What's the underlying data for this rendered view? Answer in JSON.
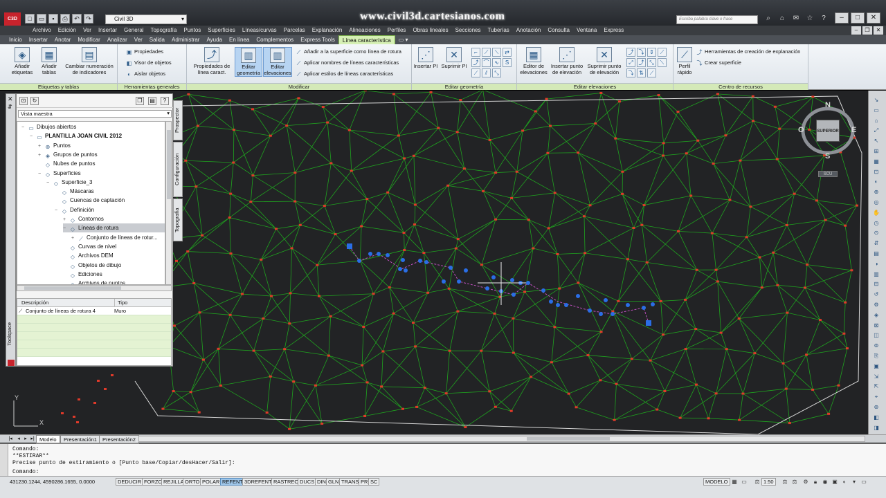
{
  "titlebar": {
    "logo": "C3D",
    "workspace": "Civil 3D",
    "watermark": "www.civil3d.cartesianos.com",
    "search_placeholder": "Escriba palabra clave o frase"
  },
  "menubar": [
    "Archivo",
    "Edición",
    "Ver",
    "Insertar",
    "General",
    "Topografía",
    "Puntos",
    "Superficies",
    "Líneas/curvas",
    "Parcelas",
    "Explanación",
    "Alineaciones",
    "Perfiles",
    "Obras lineales",
    "Secciones",
    "Tuberías",
    "Anotación",
    "Consulta",
    "Ventana",
    "Express"
  ],
  "ribbon_tabs": [
    "Inicio",
    "Insertar",
    "Anotar",
    "Modificar",
    "Analizar",
    "Ver",
    "Salida",
    "Administrar",
    "Ayuda",
    "En línea",
    "Complementos",
    "Express Tools",
    "Línea característica"
  ],
  "ribbon_tabs_active": "Línea característica",
  "ribbon": {
    "etiquetas": {
      "title": "Etiquetas y tablas",
      "anadir_etiquetas": "Añadir etiquetas",
      "anadir_tablas": "Añadir tablas",
      "cambiar_numeracion": "Cambiar numeración de indicadores"
    },
    "herramientas": {
      "title": "Herramientas generales",
      "propiedades": "Propiedades",
      "visor": "Visor de objetos",
      "aislar": "Aislar objetos"
    },
    "modificar": {
      "title": "Modificar",
      "propiedades_linea": "Propiedades de línea caract.",
      "editar_geometria": "Editar geometría",
      "editar_elevaciones": "Editar elevaciones",
      "anadir_superficie": "Añadir a la superficie como línea de rotura",
      "aplicar_nombres": "Aplicar nombres de líneas características",
      "aplicar_estilos": "Aplicar estilos de líneas características"
    },
    "editar_geometria": {
      "title": "Editar geometría",
      "insertar_pi": "Insertar PI",
      "suprimir_pi": "Suprimir PI"
    },
    "editar_elevaciones": {
      "title": "Editar elevaciones",
      "editor_elevaciones": "Editor de elevaciones",
      "insertar_punto": "Insertar punto de elevación",
      "suprimir_punto": "Suprimir punto de elevación"
    },
    "centro_recursos": {
      "title": "Centro de recursos",
      "perfil_rapido": "Perfil rápido",
      "herramientas_explanacion": "Herramientas de creación de explanación",
      "crear_superficie": "Crear superficie"
    }
  },
  "prospector": {
    "view_select": "Vista maestra",
    "tabs": [
      "Prospector",
      "Configuración",
      "Topografía"
    ],
    "toolspace_label": "Toolspace",
    "tree": [
      {
        "label": "Dibujos abiertos"
      },
      {
        "label": "PLANTILLA JOAN CIVIL 2012"
      },
      {
        "label": "Puntos"
      },
      {
        "label": "Grupos de puntos"
      },
      {
        "label": "Nubes de puntos"
      },
      {
        "label": "Superficies"
      },
      {
        "label": "Superficie_3"
      },
      {
        "label": "Máscaras"
      },
      {
        "label": "Cuencas de captación"
      },
      {
        "label": "Definición"
      },
      {
        "label": "Contornos"
      },
      {
        "label": "Líneas de rotura"
      },
      {
        "label": "Conjunto de líneas de rotur..."
      },
      {
        "label": "Curvas de nivel"
      },
      {
        "label": "Archivos DEM"
      },
      {
        "label": "Objetos de dibujo"
      },
      {
        "label": "Ediciones"
      },
      {
        "label": "Archivos de puntos"
      }
    ],
    "list": {
      "headers": [
        "Descripción",
        "Tipo"
      ],
      "rows": [
        [
          "Conjunto de líneas de rotura 4",
          "Muro"
        ]
      ]
    }
  },
  "viewcube": {
    "north": "N",
    "south": "S",
    "east": "E",
    "west": "O",
    "face": "SUPERIOR",
    "ucs": "SCU"
  },
  "axis": {
    "y": "Y",
    "x": "X"
  },
  "layout_tabs": [
    "Modelo",
    "Presentación1",
    "Presentación2"
  ],
  "command_lines": [
    "Comando:",
    "**ESTIRAR**",
    "Precise punto de estiramiento o [Punto base/Copiar/desHacer/Salir]:",
    "Comando:"
  ],
  "statusbar": {
    "coords": "431230.1244, 4590286.1655, 0.0000",
    "toggles": [
      {
        "label": "DEDUCIR",
        "on": false
      },
      {
        "label": "FORZC",
        "on": false
      },
      {
        "label": "REJILLA",
        "on": false
      },
      {
        "label": "ORTO",
        "on": false
      },
      {
        "label": "POLAR",
        "on": false
      },
      {
        "label": "REFENT",
        "on": true
      },
      {
        "label": "3DREFENT",
        "on": false
      },
      {
        "label": "RASTREO",
        "on": false
      },
      {
        "label": "DUCS",
        "on": false
      },
      {
        "label": "DIN",
        "on": false
      },
      {
        "label": "GLN",
        "on": false
      },
      {
        "label": "TRANS",
        "on": false
      },
      {
        "label": "PR",
        "on": false
      },
      {
        "label": "SC",
        "on": false
      }
    ],
    "modelo": "MODELO",
    "scale": "1:50"
  },
  "colors": {
    "canvas_bg": "#222325",
    "tin_lines": "#1fa31f",
    "point_marker": "#e03a2a",
    "grip": "#2a6ee6",
    "breakline": "#c050c0",
    "ribbon_green": "#d4e9b8"
  }
}
